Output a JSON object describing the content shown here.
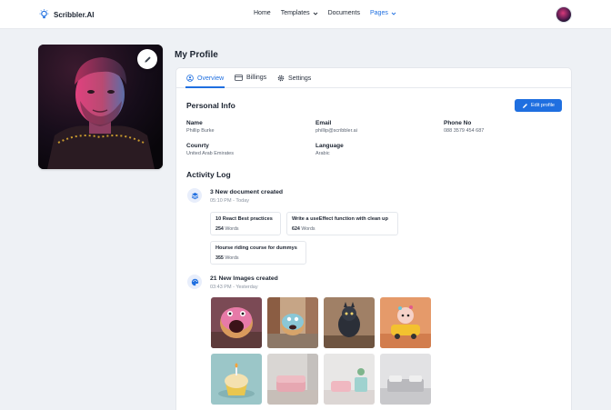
{
  "brand": {
    "name": "Scribbler.AI"
  },
  "nav": {
    "home": "Home",
    "templates": "Templates",
    "documents": "Documents",
    "pages": "Pages"
  },
  "profile": {
    "page_title": "My Profile",
    "tabs": [
      "Overview",
      "Billings",
      "Settings"
    ],
    "personal_info_title": "Personal Info",
    "edit_label": "Edit profile",
    "fields": {
      "name_label": "Name",
      "name_value": "Phillip Burke",
      "email_label": "Email",
      "email_value": "phillip@scribbler.ai",
      "phone_label": "Phone No",
      "phone_value": "088 3579 454 687",
      "country_label": "Counrty",
      "country_value": "United Arab Emirates",
      "language_label": "Language",
      "language_value": "Arabic"
    }
  },
  "activity": {
    "title": "Activity Log",
    "items": [
      {
        "title": "3 New document created",
        "time": "05:10 PM - Today",
        "docs": [
          {
            "title": "10 React Best practices",
            "count": "254",
            "unit": "Words"
          },
          {
            "title": "Write a useEffect function with clean up",
            "count": "624",
            "unit": "Words"
          },
          {
            "title": "Hourse riding course for dummys",
            "count": "355",
            "unit": "Words"
          }
        ]
      },
      {
        "title": "21 New Images created",
        "time": "03:43 PM - Yesterday"
      }
    ]
  },
  "colors": {
    "accent": "#1f6fe0",
    "background": "#eef1f5"
  },
  "icons": {
    "logo": "lightbulb-icon",
    "edit": "pencil-icon",
    "overview": "user-circle-icon",
    "billings": "credit-card-icon",
    "settings": "gear-icon",
    "doc_activity": "layers-icon",
    "image_activity": "palette-icon"
  }
}
